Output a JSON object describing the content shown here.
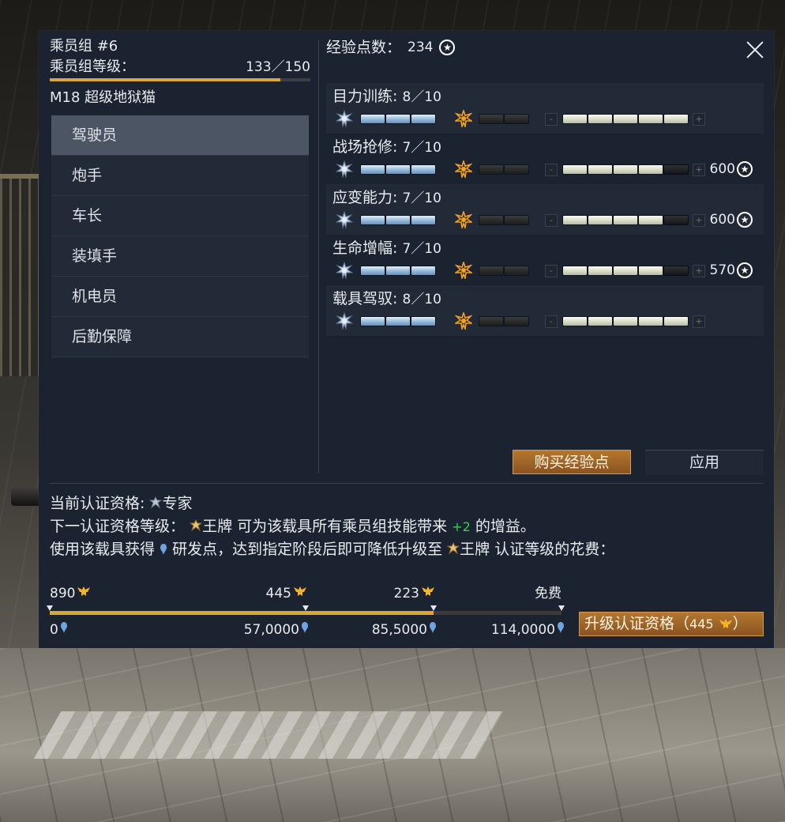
{
  "crew": {
    "name": "乘员组 #6",
    "level_label": "乘员组等级：",
    "level_value": "133／150",
    "level_progress": 0.886,
    "vehicle": "M18 超级地狱猫"
  },
  "roles": [
    {
      "label": "驾驶员",
      "active": true
    },
    {
      "label": "炮手",
      "active": false
    },
    {
      "label": "车长",
      "active": false
    },
    {
      "label": "装填手",
      "active": false
    },
    {
      "label": "机电员",
      "active": false
    },
    {
      "label": "后勤保障",
      "active": false
    }
  ],
  "xp": {
    "label": "经验点数：",
    "value": "234"
  },
  "skills": [
    {
      "name": "目力训练",
      "level": "8／10",
      "cream_filled": 5,
      "cost": ""
    },
    {
      "name": "战场抢修",
      "level": "7／10",
      "cream_filled": 4,
      "cost": "600"
    },
    {
      "name": "应变能力",
      "level": "7／10",
      "cream_filled": 4,
      "cost": "600"
    },
    {
      "name": "生命增幅",
      "level": "7／10",
      "cream_filled": 4,
      "cost": "570"
    },
    {
      "name": "载具驾驭",
      "level": "8／10",
      "cream_filled": 5,
      "cost": ""
    }
  ],
  "buttons": {
    "buy_xp": "购买经验点",
    "apply": "应用",
    "upgrade": "升级认证资格（",
    "upgrade_cost": "445",
    "upgrade_close": "）"
  },
  "qualification": {
    "current_label": "当前认证资格:",
    "current_value": "专家",
    "next_prefix": "下一认证资格等级：",
    "next_value": "王牌",
    "next_suffix_a": "可为该载具所有乘员组技能带来",
    "bonus": "+2",
    "next_suffix_b": "的增益。",
    "rp_prefix": "使用该载具获得",
    "rp_middle": "研发点，达到指定阶段后即可降低升级至",
    "rp_value": "王牌",
    "rp_suffix": "认证等级的花费："
  },
  "milestones": {
    "costs": [
      "890",
      "445",
      "223",
      "免费"
    ],
    "rp": [
      "0",
      "57,0000",
      "85,5000",
      "114,0000"
    ],
    "progress": 0.75
  },
  "colors": {
    "accent": "#e0a23a",
    "button_gold": "#a86d2a",
    "panel": "#1b2230",
    "bonus_green": "#34d14b"
  },
  "icons": [
    "close-icon",
    "star-coin-icon",
    "rank-medal-icon",
    "ace-medal-icon",
    "eagle-icon",
    "research-point-icon"
  ]
}
